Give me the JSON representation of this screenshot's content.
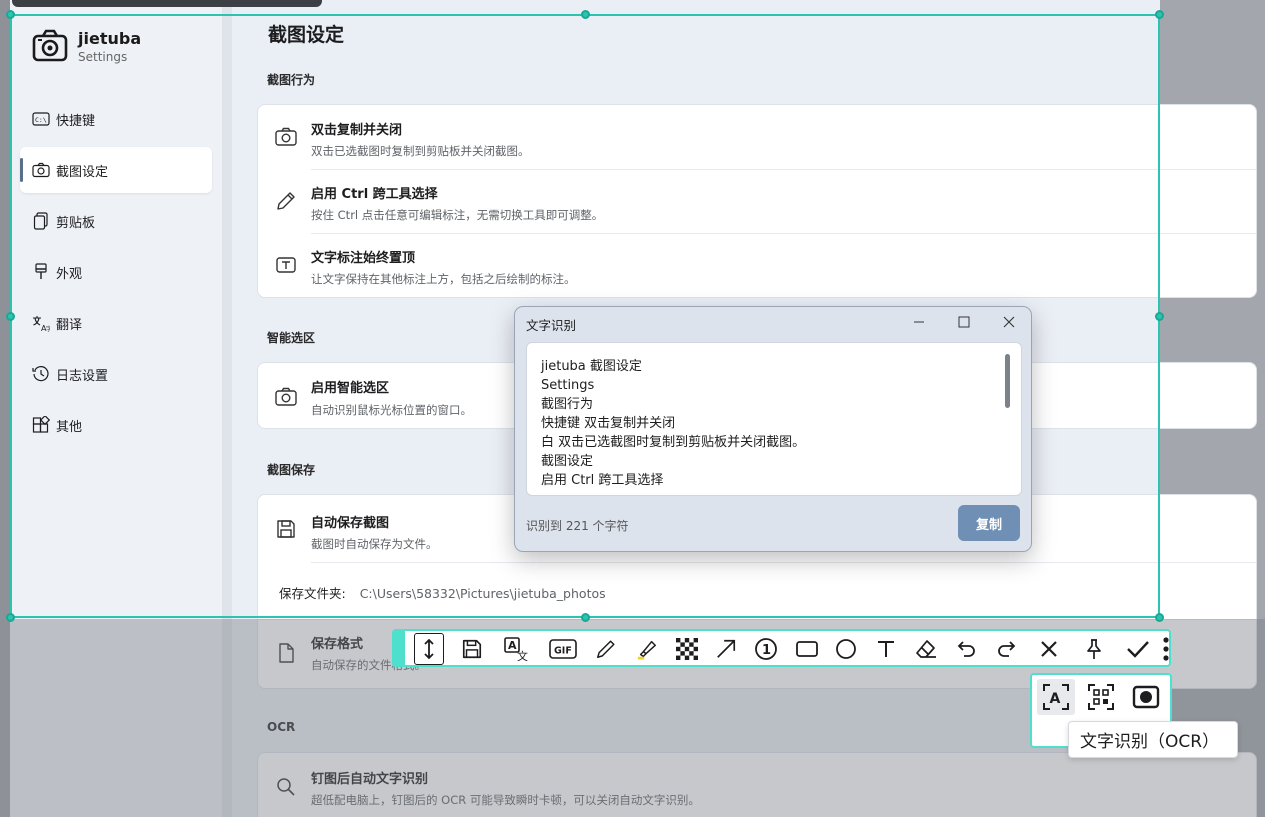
{
  "app": {
    "name": "jietuba",
    "subtitle": "Settings"
  },
  "sidebar": {
    "items": [
      {
        "label": "快捷键",
        "icon": "keyboard-icon"
      },
      {
        "label": "截图设定",
        "icon": "camera-icon",
        "active": true
      },
      {
        "label": "剪贴板",
        "icon": "clipboard-icon"
      },
      {
        "label": "外观",
        "icon": "brush-icon"
      },
      {
        "label": "翻译",
        "icon": "translate-icon"
      },
      {
        "label": "日志设置",
        "icon": "history-icon"
      },
      {
        "label": "其他",
        "icon": "apps-icon"
      }
    ]
  },
  "main": {
    "title": "截图设定",
    "sections": {
      "behavior": {
        "label": "截图行为",
        "rows": [
          {
            "title": "双击复制并关闭",
            "desc": "双击已选截图时复制到剪贴板并关闭截图。",
            "icon": "camera-icon"
          },
          {
            "title": "启用 Ctrl 跨工具选择",
            "desc": "按住 Ctrl 点击任意可编辑标注，无需切换工具即可调整。",
            "icon": "pencil-icon"
          },
          {
            "title": "文字标注始终置顶",
            "desc": "让文字保持在其他标注上方，包括之后绘制的标注。",
            "icon": "text-icon"
          }
        ]
      },
      "smart": {
        "label": "智能选区",
        "rows": [
          {
            "title": "启用智能选区",
            "desc": "自动识别鼠标光标位置的窗口。",
            "icon": "camera-icon"
          }
        ]
      },
      "save": {
        "label": "截图保存",
        "rows": [
          {
            "title": "自动保存截图",
            "desc": "截图时自动保存为文件。",
            "icon": "save-icon"
          },
          {
            "title": "保存格式",
            "desc": "自动保存的文件格式。",
            "icon": "file-icon"
          }
        ],
        "folder_label": "保存文件夹:",
        "folder_path": "C:\\Users\\58332\\Pictures\\jietuba_photos"
      },
      "ocr": {
        "label": "OCR",
        "rows": [
          {
            "title": "钉图后自动文字识别",
            "desc": "超低配电脑上，钉图后的 OCR 可能导致瞬时卡顿，可以关闭自动文字识别。",
            "icon": "search-icon"
          }
        ]
      }
    }
  },
  "ocr_dialog": {
    "title": "文字识别",
    "lines": [
      "jietuba 截图设定",
      "Settings",
      "截图行为",
      "快捷键 双击复制并关闭",
      "白 双击已选截图时复制到剪贴板并关闭截图。",
      "截图设定",
      "启用 Ctrl 跨工具选择"
    ],
    "count_text": "识别到 221 个字符",
    "copy_label": "复制"
  },
  "toolbar": {
    "tools": [
      "long-screenshot-icon",
      "save-icon",
      "translate-icon",
      "gif-icon",
      "pen-icon",
      "highlighter-icon",
      "mosaic-icon",
      "arrow-icon",
      "number-icon",
      "rectangle-icon",
      "ellipse-icon",
      "text-icon",
      "eraser-icon",
      "undo-icon",
      "redo-icon",
      "close-icon",
      "pin-icon",
      "confirm-icon"
    ],
    "gif_label": "GIF",
    "number_label": "1",
    "text_label": "T"
  },
  "subbar": {
    "tools": [
      "ocr-icon",
      "qr-scan-icon",
      "window-capture-icon"
    ]
  },
  "tooltip": {
    "text": "文字识别（OCR）"
  },
  "colors": {
    "selection": "#2bc4b0",
    "toolbar_accent": "#4ee0cd",
    "copy_button": "#6f8fb5"
  }
}
